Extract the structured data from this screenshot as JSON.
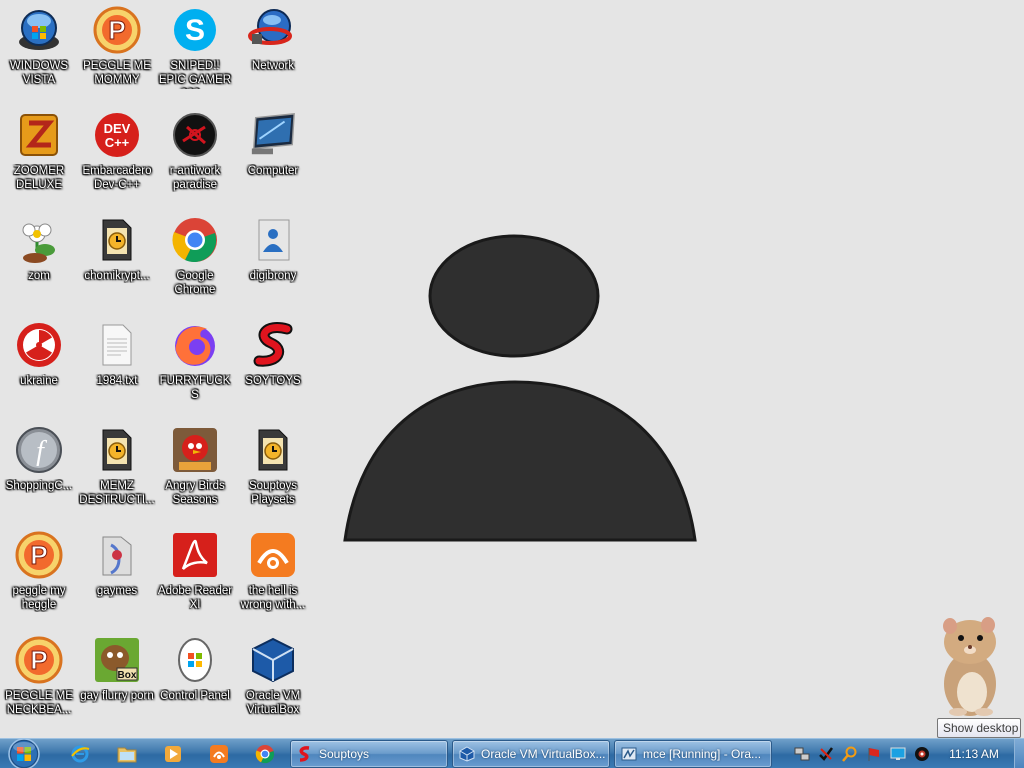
{
  "desktop": {
    "icons": [
      {
        "label": "WINDOWS VISTA",
        "icon": "windows-vista-icon"
      },
      {
        "label": "PEGGLE ME MOMMY",
        "icon": "peggle-icon"
      },
      {
        "label": "SNIPED!! EPIC GAMER 360...",
        "icon": "skype-icon"
      },
      {
        "label": "Network",
        "icon": "network-icon"
      },
      {
        "label": "ZOOMER DELUXE",
        "icon": "zuma-icon"
      },
      {
        "label": "Embarcadero Dev-C++",
        "icon": "dev-cpp-icon"
      },
      {
        "label": "r-antiwork paradise",
        "icon": "antiwork-icon"
      },
      {
        "label": "Computer",
        "icon": "computer-icon"
      },
      {
        "label": "zom",
        "icon": "plants-icon"
      },
      {
        "label": "chomikrypt...",
        "icon": "file-clock-icon"
      },
      {
        "label": "Google Chrome",
        "icon": "chrome-icon"
      },
      {
        "label": "digibrony",
        "icon": "user-folder-icon"
      },
      {
        "label": "ukraine",
        "icon": "radiation-icon"
      },
      {
        "label": "1984.txt",
        "icon": "text-file-icon"
      },
      {
        "label": "FURRYFUCKS",
        "icon": "firefox-icon"
      },
      {
        "label": "SOYTOYS",
        "icon": "souptoys-icon"
      },
      {
        "label": "ShoppingC...",
        "icon": "flash-icon"
      },
      {
        "label": "MEMZ DESTRUCTI...",
        "icon": "file-clock-icon"
      },
      {
        "label": "Angry Birds Seasons",
        "icon": "angry-birds-icon"
      },
      {
        "label": "Souptoys Playsets",
        "icon": "file-clock-icon"
      },
      {
        "label": "peggle my heggle",
        "icon": "peggle-icon"
      },
      {
        "label": "gaymes",
        "icon": "folder-icon"
      },
      {
        "label": "Adobe Reader XI",
        "icon": "adobe-reader-icon"
      },
      {
        "label": "the hell is wrong with...",
        "icon": "uc-browser-icon"
      },
      {
        "label": "PEGGLE ME NECKBEA...",
        "icon": "peggle-icon"
      },
      {
        "label": "gay flurry porn",
        "icon": "beaver-box-icon"
      },
      {
        "label": "Control Panel",
        "icon": "control-panel-icon"
      },
      {
        "label": "Oracle VM VirtualBox",
        "icon": "virtualbox-icon"
      }
    ]
  },
  "taskbar": {
    "quick_launch": [
      "internet-explorer-icon",
      "explorer-folder-icon",
      "media-player-icon",
      "uc-browser-icon",
      "chrome-icon"
    ],
    "tasks": [
      {
        "label": "Souptoys",
        "icon": "souptoys-icon"
      },
      {
        "label": "Oracle VM VirtualBox...",
        "icon": "virtualbox-icon"
      },
      {
        "label": "mce [Running] - Ora...",
        "icon": "virtualbox-vm-icon"
      }
    ],
    "clock": "11:13 AM",
    "tray_icons": [
      "network-tray-icon",
      "checkmark-tray-icon",
      "search-tray-icon",
      "flag-tray-icon",
      "monitor-tray-icon",
      "speaker-tray-icon"
    ]
  },
  "tooltip": {
    "text": "Show desktop"
  },
  "colors": {
    "taskbar": "#3f78ad",
    "desktop": "#e5e5e5",
    "silhouette": "#2f2f2f"
  }
}
